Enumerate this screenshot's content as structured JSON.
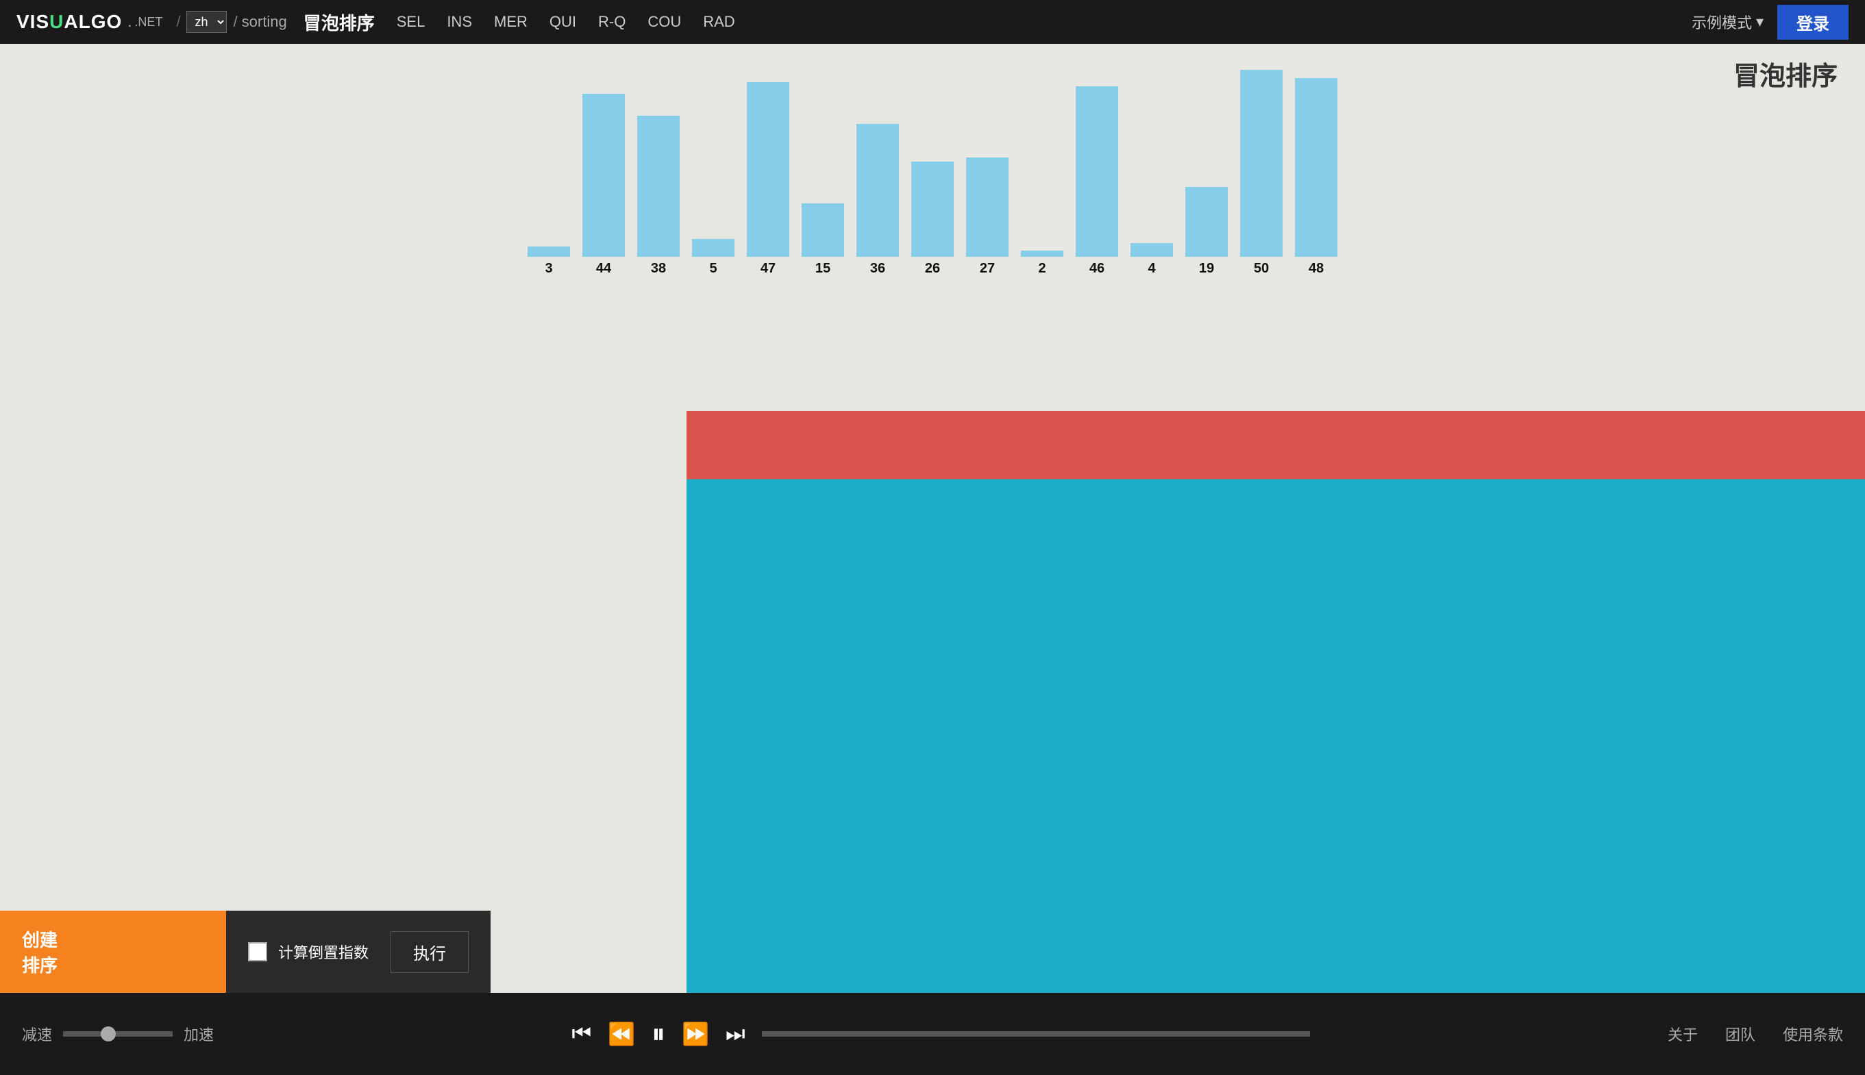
{
  "nav": {
    "logo": "VISUALGO",
    "logo_net": ".NET",
    "lang": "zh",
    "slash": "/",
    "sorting": "sorting",
    "page_title": "冒泡排序",
    "links": [
      {
        "label": "SEL",
        "id": "sel"
      },
      {
        "label": "INS",
        "id": "ins"
      },
      {
        "label": "MER",
        "id": "mer"
      },
      {
        "label": "QUI",
        "id": "qui"
      },
      {
        "label": "R-Q",
        "id": "rq"
      },
      {
        "label": "COU",
        "id": "cou"
      },
      {
        "label": "RAD",
        "id": "rad"
      }
    ],
    "example_mode": "示例模式",
    "login": "登录"
  },
  "chart": {
    "bars": [
      {
        "value": 3,
        "height_pct": 5
      },
      {
        "value": 44,
        "height_pct": 82
      },
      {
        "value": 38,
        "height_pct": 71
      },
      {
        "value": 5,
        "height_pct": 9
      },
      {
        "value": 47,
        "height_pct": 88
      },
      {
        "value": 15,
        "height_pct": 27
      },
      {
        "value": 36,
        "height_pct": 67
      },
      {
        "value": 26,
        "height_pct": 48
      },
      {
        "value": 27,
        "height_pct": 50
      },
      {
        "value": 2,
        "height_pct": 3
      },
      {
        "value": 46,
        "height_pct": 86
      },
      {
        "value": 4,
        "height_pct": 7
      },
      {
        "value": 19,
        "height_pct": 35
      },
      {
        "value": 50,
        "height_pct": 94
      },
      {
        "value": 48,
        "height_pct": 90
      }
    ]
  },
  "algo": {
    "title": "冒泡排序"
  },
  "controls": {
    "create_label": "创建",
    "sort_label": "排序",
    "calc_inversion_label": "计算倒置指数",
    "execute_label": "执行",
    "speed_slow": "减速",
    "speed_fast": "加速"
  },
  "footer": {
    "about": "关于",
    "team": "团队",
    "terms": "使用条款"
  }
}
